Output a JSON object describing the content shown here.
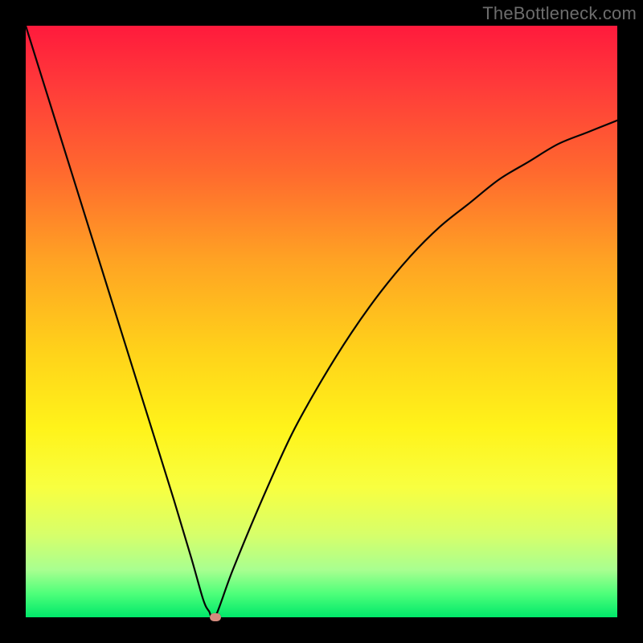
{
  "watermark": "TheBottleneck.com",
  "chart_data": {
    "type": "line",
    "title": "",
    "xlabel": "",
    "ylabel": "",
    "xlim": [
      0,
      100
    ],
    "ylim": [
      0,
      100
    ],
    "grid": false,
    "series": [
      {
        "name": "bottleneck-curve",
        "x": [
          0,
          5,
          10,
          15,
          20,
          25,
          28,
          30,
          31,
          32,
          35,
          40,
          45,
          50,
          55,
          60,
          65,
          70,
          75,
          80,
          85,
          90,
          95,
          100
        ],
        "values": [
          100,
          84,
          68,
          52,
          36,
          20,
          10,
          3,
          1,
          0,
          8,
          20,
          31,
          40,
          48,
          55,
          61,
          66,
          70,
          74,
          77,
          80,
          82,
          84
        ]
      }
    ],
    "marker": {
      "x": 32,
      "y": 0
    },
    "background_gradient": {
      "top": "#ff1a3c",
      "bottom": "#00e86a"
    }
  }
}
